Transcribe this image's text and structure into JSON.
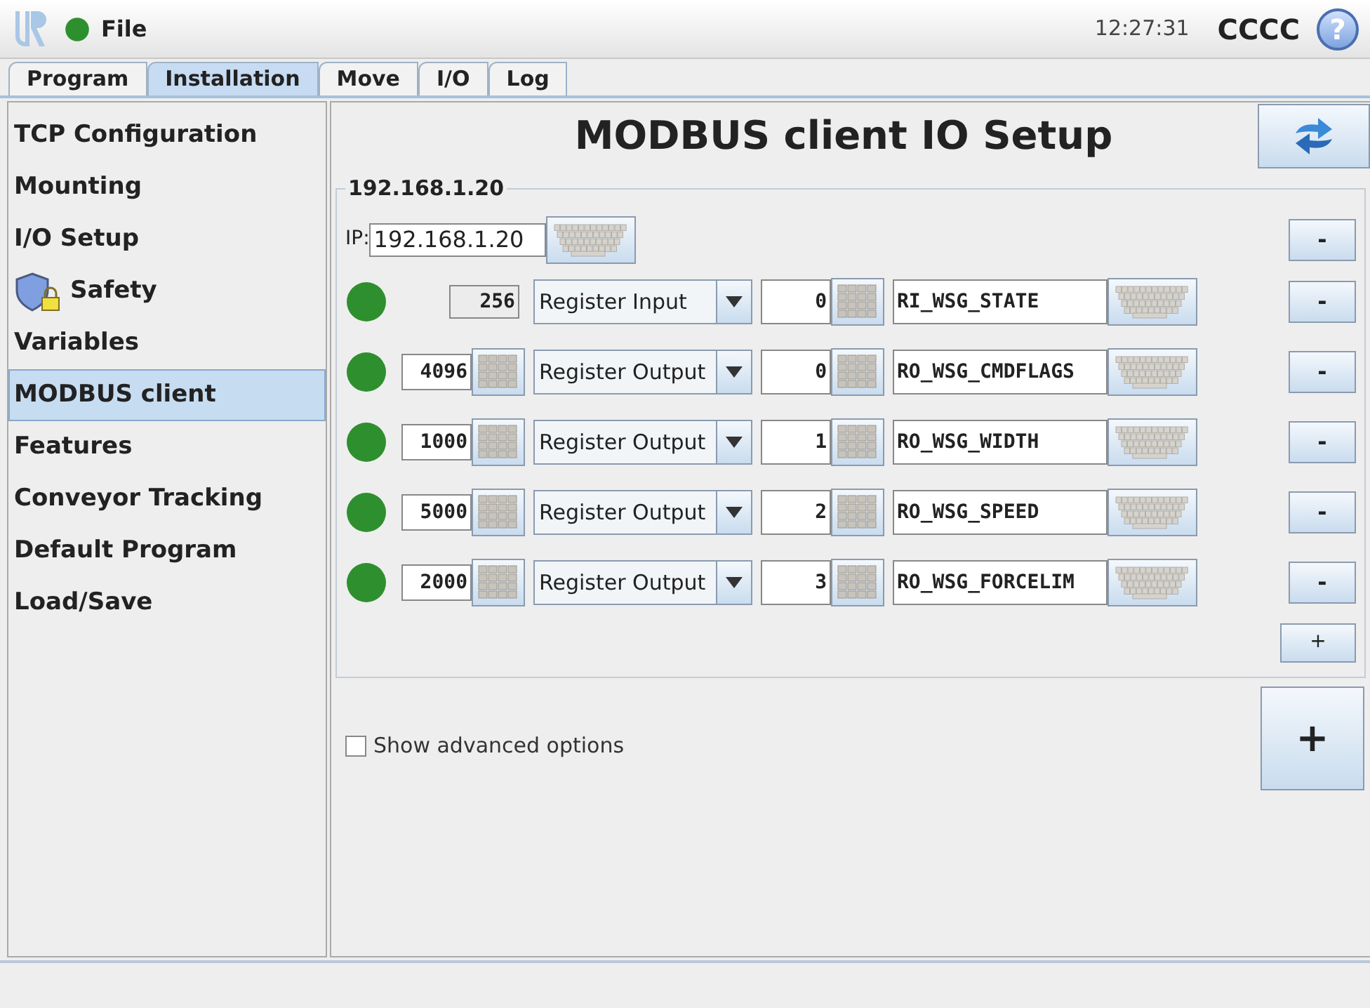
{
  "top_bar": {
    "color": "#2e8f2e",
    "menu": "File",
    "time": "12:27:31",
    "robot_name": "CCCC",
    "help": "?"
  },
  "tabs": [
    {
      "label": "Program",
      "selected": false
    },
    {
      "label": "Installation",
      "selected": true
    },
    {
      "label": "Move",
      "selected": false
    },
    {
      "label": "I/O",
      "selected": false
    },
    {
      "label": "Log",
      "selected": false
    }
  ],
  "sidebar": {
    "items": [
      {
        "label": "TCP Configuration",
        "kind": "text",
        "selected": false
      },
      {
        "label": "Mounting",
        "kind": "text",
        "selected": false
      },
      {
        "label": "I/O Setup",
        "kind": "text",
        "selected": false
      },
      {
        "label": "Safety",
        "kind": "safety",
        "selected": false
      },
      {
        "label": "Variables",
        "kind": "text",
        "selected": false
      },
      {
        "label": "MODBUS client",
        "kind": "text",
        "selected": true
      },
      {
        "label": "Features",
        "kind": "text",
        "selected": false
      },
      {
        "label": "Conveyor Tracking",
        "kind": "text",
        "selected": false
      },
      {
        "label": "Default Program",
        "kind": "text",
        "selected": false
      },
      {
        "label": "Load/Save",
        "kind": "text",
        "selected": false
      }
    ]
  },
  "main": {
    "title": "MODBUS client IO Setup",
    "unit": {
      "legend": "192.168.1.20",
      "ip_label": "IP:",
      "ip": "192.168.1.20",
      "remove": "-",
      "signals": [
        {
          "color": "#2e8f2e",
          "address": "256",
          "address_editable": false,
          "type": "Register Input",
          "register": "0",
          "name": "RI_WSG_STATE",
          "remove": "-"
        },
        {
          "color": "#2e8f2e",
          "address": "4096",
          "address_editable": true,
          "type": "Register Output",
          "register": "0",
          "name": "RO_WSG_CMDFLAGS",
          "remove": "-"
        },
        {
          "color": "#2e8f2e",
          "address": "1000",
          "address_editable": true,
          "type": "Register Output",
          "register": "1",
          "name": "RO_WSG_WIDTH",
          "remove": "-"
        },
        {
          "color": "#2e8f2e",
          "address": "5000",
          "address_editable": true,
          "type": "Register Output",
          "register": "2",
          "name": "RO_WSG_SPEED",
          "remove": "-"
        },
        {
          "color": "#2e8f2e",
          "address": "2000",
          "address_editable": true,
          "type": "Register Output",
          "register": "3",
          "name": "RO_WSG_FORCELIM",
          "remove": "-"
        }
      ],
      "add_signal": "+"
    },
    "advanced": {
      "label": "Show advanced options",
      "checked": false
    },
    "add_unit": "+"
  }
}
